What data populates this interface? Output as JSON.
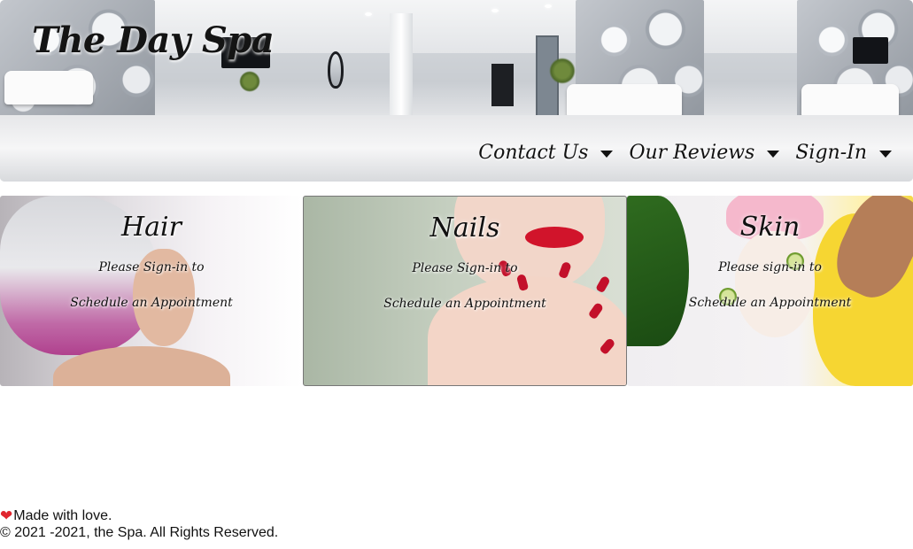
{
  "header": {
    "site_title": "The Day Spa",
    "nav": [
      {
        "label": "Contact Us"
      },
      {
        "label": "Our Reviews"
      },
      {
        "label": "Sign-In"
      }
    ]
  },
  "services": [
    {
      "title": "Hair",
      "line1": "Please Sign-in to",
      "line2": "Schedule an Appointment"
    },
    {
      "title": "Nails",
      "line1": "Please Sign-in to",
      "line2": "Schedule an Appointment"
    },
    {
      "title": "Skin",
      "line1": "Please sign-in to",
      "line2": "Schedule an Appointment"
    }
  ],
  "footer": {
    "heart_icon": "heart-icon",
    "made_with": "Made with love.",
    "copyright": "© 2021 -2021, the Spa. All Rights Reserved."
  },
  "colors": {
    "text": "#111111",
    "heart": "#e0262f",
    "nail_polish": "#c3102a"
  }
}
